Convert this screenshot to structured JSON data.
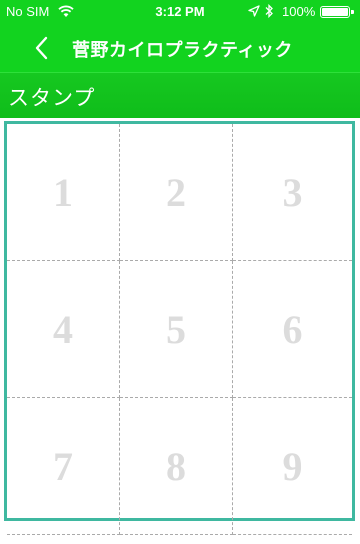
{
  "status": {
    "carrier": "No SIM",
    "time": "3:12 PM",
    "battery": "100%",
    "battery_level": 1.0,
    "icons": [
      "wifi-icon",
      "location-arrow-icon",
      "bluetooth-icon",
      "battery-icon"
    ]
  },
  "nav": {
    "back_icon": "chevron-left-icon",
    "title": "菅野カイロプラクティック"
  },
  "section": {
    "title": "スタンプ"
  },
  "stamps": {
    "labels": [
      "1",
      "2",
      "3",
      "4",
      "5",
      "6",
      "7",
      "8",
      "9"
    ]
  },
  "colors": {
    "header_green": "#12d31f",
    "card_border": "#3fb8a0",
    "stamp_number": "#dcdcdc"
  }
}
